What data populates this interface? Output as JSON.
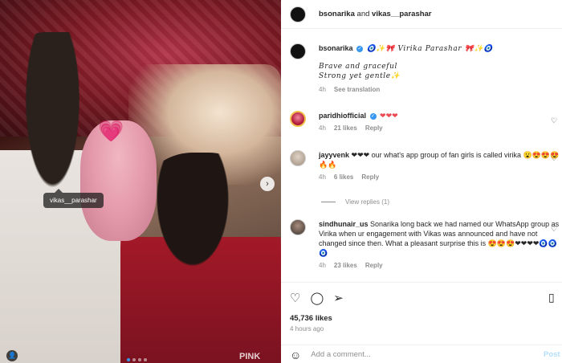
{
  "header": {
    "user1": "bsonarika",
    "and": "and",
    "user2": "vikas__parashar"
  },
  "media": {
    "tag_label": "vikas__parashar",
    "watermark": "PINK",
    "sticker": "💗"
  },
  "caption": {
    "username": "bsonarika",
    "title_line": "🧿✨🎀 Virika Parashar 🎀✨🧿",
    "line1": "Brave and graceful",
    "line2": "Strong yet gentle✨",
    "time": "4h",
    "see_translation": "See translation"
  },
  "comments": [
    {
      "username": "paridhiofficial",
      "verified": true,
      "text": "❤❤❤",
      "time": "4h",
      "likes": "21 likes",
      "reply": "Reply"
    },
    {
      "username": "jayyvenk",
      "verified": false,
      "text": "❤❤❤ our what's app group of fan girls is called virika 😮😍😍😍 🔥🔥",
      "time": "4h",
      "likes": "6 likes",
      "reply": "Reply"
    },
    {
      "username": "sindhunair_us",
      "verified": false,
      "text": "Sonarika long back we had named our WhatsApp group as Virika when ur engagement with Vikas was announced and have not changed since then. What a pleasant surprise this is 😍😍😍❤❤❤❤🧿🧿🧿",
      "time": "4h",
      "likes": "23 likes",
      "reply": "Reply"
    }
  ],
  "view_replies": "View replies (1)",
  "stats": {
    "likes": "45,736 likes",
    "time": "4 hours ago"
  },
  "comment_input": {
    "placeholder": "Add a comment...",
    "post": "Post"
  },
  "colors": {
    "accent": "#3897f0",
    "heart": "#ed4956",
    "muted": "#8e8e8e"
  }
}
